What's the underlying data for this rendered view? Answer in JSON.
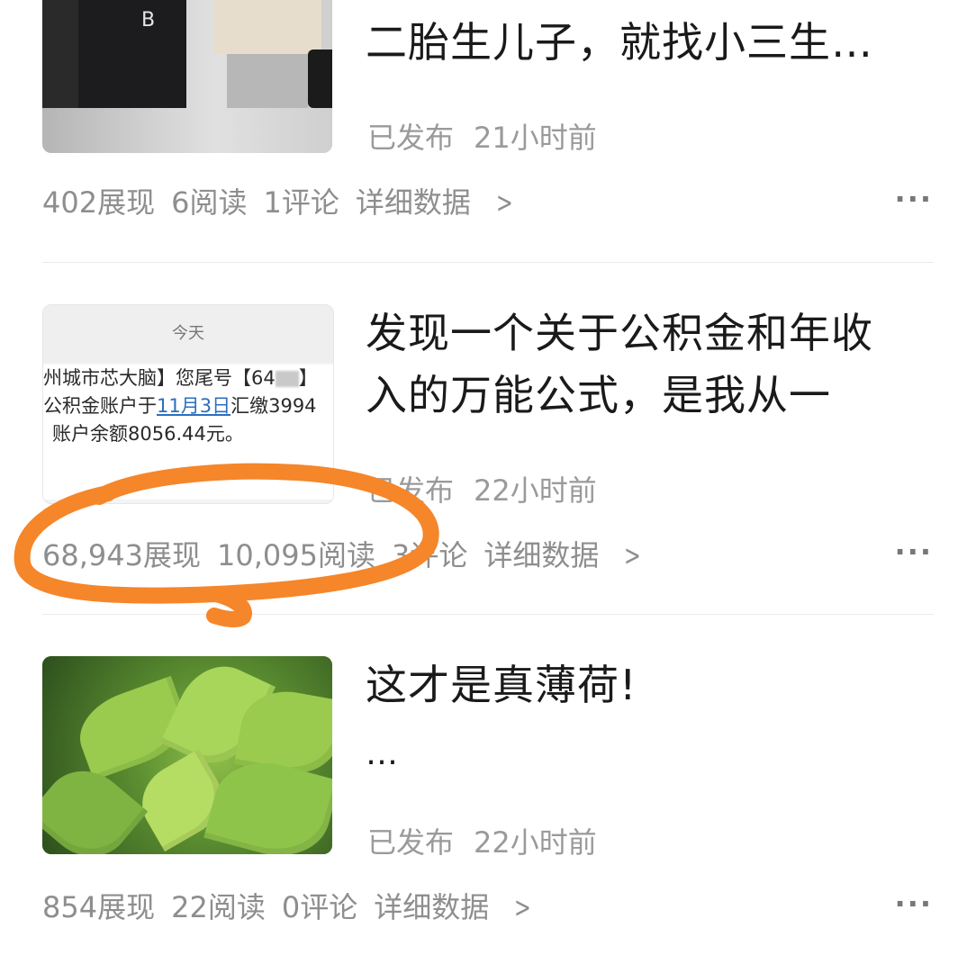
{
  "posts": [
    {
      "title": "二胎生儿子，就找小三生…",
      "title_partial_top": "",
      "status": "已发布",
      "time": "21小时前",
      "impressions": "402展现",
      "reads": "6阅读",
      "comments": "1评论",
      "detail": "详细数据",
      "more": "···"
    },
    {
      "title": "发现一个关于公积金和年收入的万能公式，是我从一",
      "status": "已发布",
      "time": "22小时前",
      "impressions": "68,943展现",
      "reads": "10,095阅读",
      "comments": "3评论",
      "detail": "详细数据",
      "more": "···",
      "thumb": {
        "header": "今天",
        "line1": "州城市芯大脑】您尾号【64",
        "line1_end": "】",
        "line2_pre": "公积金账户于",
        "line2_link": "11月3日",
        "line2_post": "汇缴3994",
        "line3": "账户余额8056.44元。"
      }
    },
    {
      "title": "这才是真薄荷!",
      "subtitle": "…",
      "status": "已发布",
      "time": "22小时前",
      "impressions": "854展现",
      "reads": "22阅读",
      "comments": "0评论",
      "detail": "详细数据",
      "more": "···"
    }
  ],
  "icons": {
    "chevron": "chevron-right-icon",
    "more": "more-dots-icon"
  },
  "colors": {
    "highlight": "#f5862a",
    "meta_text": "#8e8e8e",
    "link": "#2c6fbf"
  }
}
